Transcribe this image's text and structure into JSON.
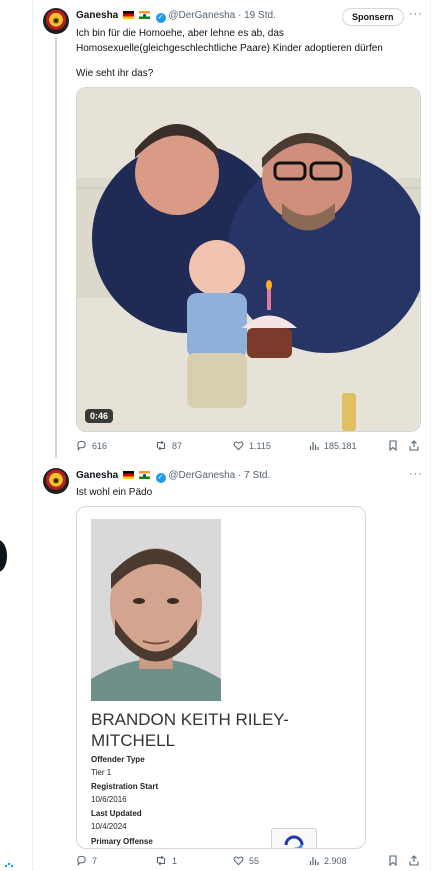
{
  "tweet1": {
    "author_name": "Ganesha",
    "handle": "@DerGanesha",
    "time": "· 19 Std.",
    "sponsor_label": "Sponsern",
    "more": "···",
    "text_line1": "Ich bin für die Homoehe, aber lehne es ab, das",
    "text_line2": "Homosexuelle(gleichgeschlechtliche Paare) Kinder adoptieren dürfen",
    "text_line3": "Wie seht ihr das?",
    "video_duration": "0:46",
    "stats": {
      "replies": "616",
      "reposts": "87",
      "likes": "1.115",
      "views": "185.181"
    }
  },
  "tweet2": {
    "author_name": "Ganesha",
    "handle": "@DerGanesha",
    "time": "· 7 Std.",
    "more": "···",
    "text": "Ist wohl ein Pädo",
    "card": {
      "name_line1": "BRANDON KEITH RILEY-",
      "name_line2": "MITCHELL",
      "fields": [
        {
          "label": "Offender Type",
          "value": "Tier 1"
        },
        {
          "label": "Registration Start",
          "value": "10/6/2016"
        },
        {
          "label": "Last Updated",
          "value": "10/4/2024"
        },
        {
          "label": "Primary Offense",
          "value": ""
        }
      ]
    },
    "stats": {
      "replies": "7",
      "reposts": "1",
      "likes": "55",
      "views": "2.908"
    }
  },
  "colors": {
    "accent": "#1d9bf0",
    "muted": "#536471",
    "border": "#cfd9de"
  },
  "icons": [
    "reply-icon",
    "repost-icon",
    "like-icon",
    "views-icon",
    "bookmark-icon",
    "share-icon",
    "verified-icon"
  ]
}
